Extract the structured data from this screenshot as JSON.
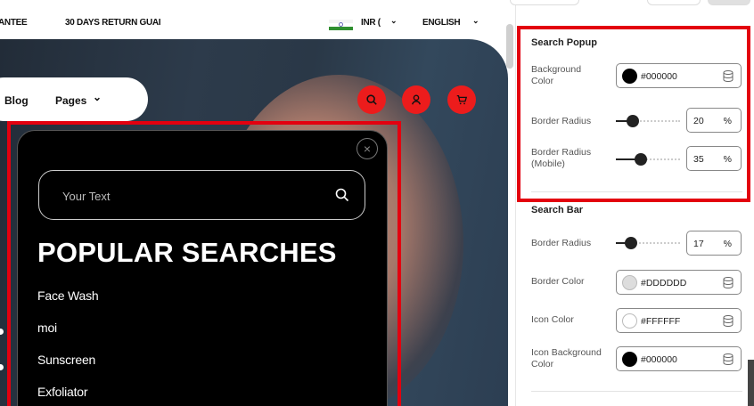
{
  "topbar": {
    "guarantee_text": "ANTEE",
    "returns_text": "30 DAYS RETURN GUAI",
    "currency": "INR (",
    "language": "ENGLISH"
  },
  "nav": {
    "blog": "Blog",
    "pages": "Pages",
    "chevron": "⌄"
  },
  "popup": {
    "close_glyph": "×",
    "placeholder": "Your Text",
    "popular_title": "POPULAR SEARCHES",
    "items": [
      "Face Wash",
      "moi",
      "Sunscreen",
      "Exfoliator"
    ]
  },
  "settings": {
    "search_popup": {
      "title": "Search Popup",
      "bg_label": "Background Color",
      "bg_value": "#000000",
      "radius_label": "Border Radius",
      "radius_value": "20",
      "radius_unit": "%",
      "radius_mobile_label": "Border Radius (Mobile)",
      "radius_mobile_value": "35",
      "radius_mobile_unit": "%"
    },
    "search_bar": {
      "title": "Search Bar",
      "radius_label": "Border Radius",
      "radius_value": "17",
      "radius_unit": "%",
      "border_color_label": "Border Color",
      "border_color_value": "#DDDDDD",
      "icon_color_label": "Icon Color",
      "icon_color_value": "#FFFFFF",
      "icon_bg_label": "Icon Background Color",
      "icon_bg_value": "#000000"
    }
  },
  "colors": {
    "accent_red": "#ec1c1c",
    "highlight_red": "#e3000f",
    "popup_bg": "#000000"
  }
}
